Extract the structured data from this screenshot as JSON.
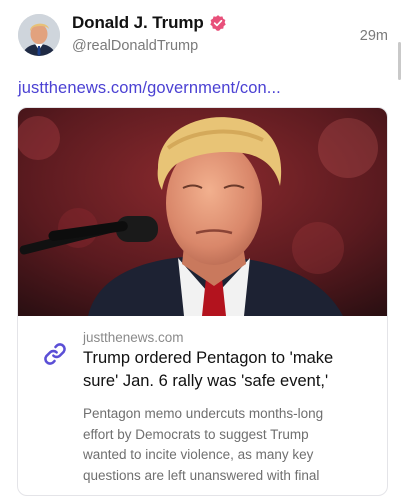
{
  "post": {
    "author_name": "Donald J. Trump",
    "handle": "@realDonaldTrump",
    "timestamp": "29m",
    "link_text": "justthenews.com/government/con..."
  },
  "card": {
    "domain": "justthenews.com",
    "title": "Trump ordered Pentagon to 'make\nsure' Jan. 6 rally was 'safe event,'",
    "description": "Pentagon memo undercuts months-long\neffort by Democrats to suggest Trump\nwanted to incite violence, as many key\nquestions are left unanswered with final"
  },
  "colors": {
    "link": "#4b41d3",
    "verified_badge": "#e8507a",
    "muted_text": "#7a7a7a"
  },
  "icons": {
    "verified": "verified-badge-icon",
    "card_link": "link-icon"
  }
}
